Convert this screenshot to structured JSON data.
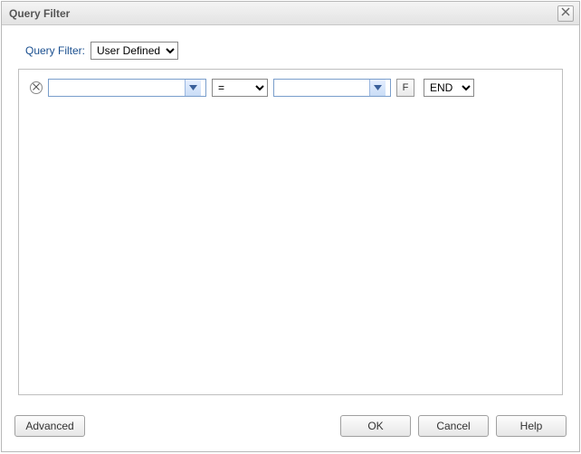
{
  "dialog": {
    "title": "Query Filter"
  },
  "filter": {
    "label": "Query Filter:",
    "type_selected": "User Defined"
  },
  "row": {
    "field_value": "",
    "operator_selected": "=",
    "value_value": "",
    "f_label": "F",
    "end_selected": "END"
  },
  "buttons": {
    "advanced": "Advanced",
    "ok": "OK",
    "cancel": "Cancel",
    "help": "Help"
  }
}
